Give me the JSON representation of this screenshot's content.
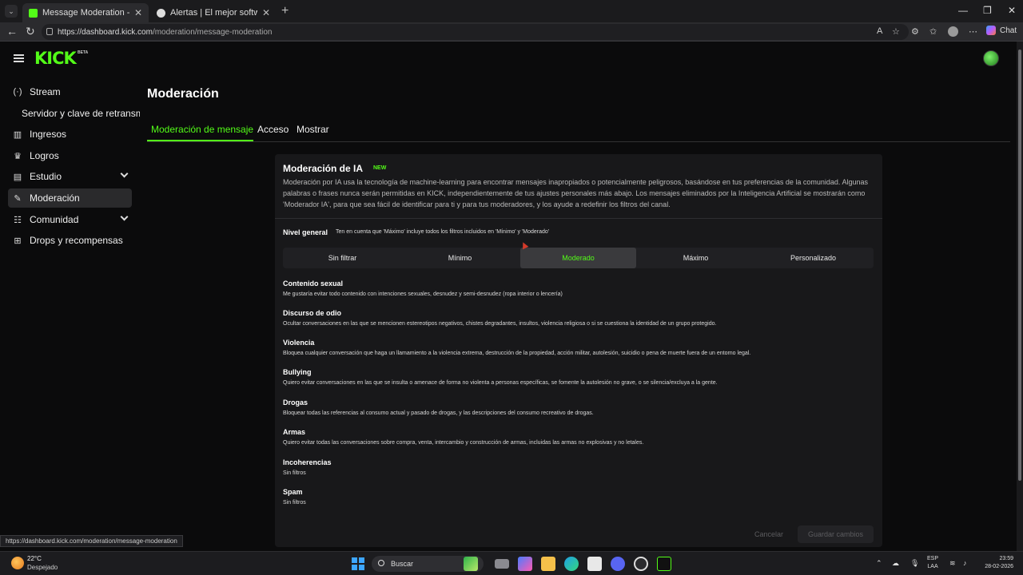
{
  "browser": {
    "tabs": [
      {
        "title": "Message Moderation - Kick Dashb",
        "active": true
      },
      {
        "title": "Alertas | El mejor software para po",
        "active": false
      }
    ],
    "url_host": "https://dashboard.kick.com",
    "url_path": "/moderation/message-moderation",
    "chat_label": "Chat",
    "status_url": "https://dashboard.kick.com/moderation/message-moderation"
  },
  "brand": {
    "logo": "KICK",
    "beta": "BETA",
    "accent": "#53fc18"
  },
  "sidebar": {
    "items": [
      {
        "icon": "stream-icon",
        "label": "Stream"
      },
      {
        "label": "Servidor y clave de retransmi"
      },
      {
        "icon": "income-icon",
        "label": "Ingresos"
      },
      {
        "icon": "trophy-icon",
        "label": "Logros"
      },
      {
        "icon": "studio-icon",
        "label": "Estudio"
      },
      {
        "icon": "wrench-icon",
        "label": "Moderación"
      },
      {
        "icon": "community-icon",
        "label": "Comunidad"
      },
      {
        "icon": "drops-icon",
        "label": "Drops y recompensas"
      }
    ]
  },
  "main": {
    "title": "Moderación",
    "tabs": [
      "Moderación de mensaje",
      "Acceso",
      "Mostrar"
    ]
  },
  "card": {
    "title": "Moderación de IA",
    "badge": "NEW",
    "description": "Moderación por IA usa la tecnología de machine-learning para encontrar mensajes inapropiados o potencialmente peligrosos, basándose en tus preferencias de la comunidad. Algunas palabras o frases nunca serán permitidas en KICK, independientemente de tus ajustes personales más abajo. Los mensajes eliminados por la Inteligencia Artificial se mostrarán como 'Moderador IA', para que sea fácil de identificar para ti y para tus moderadores, y los ayude a redefinir los filtros del canal.",
    "nivel_label": "Nivel general",
    "nivel_hint": "Ten en cuenta que 'Máximo' incluye todos los filtros incluidos en 'Mínimo' y 'Moderado'",
    "levels": [
      "Sin filtrar",
      "Mínimo",
      "Moderado",
      "Máximo",
      "Personalizado"
    ],
    "selected_level": "Moderado",
    "categories": [
      {
        "title": "Contenido sexual",
        "desc": "Me gustaría evitar todo contenido con intenciones sexuales, desnudez y semi-desnudez (ropa interior o lencería)"
      },
      {
        "title": "Discurso de odio",
        "desc": "Ocultar conversaciones en las que se mencionen estereotipos negativos, chistes degradantes, insultos, violencia religiosa o si se cuestiona la identidad de un grupo protegido."
      },
      {
        "title": "Violencia",
        "desc": "Bloquea cualquier conversación que haga un llamamiento a la violencia extrema, destrucción de la propiedad, acción militar, autolesión, suicidio o pena de muerte fuera de un entorno legal."
      },
      {
        "title": "Bullying",
        "desc": "Quiero evitar conversaciones en las que se insulta o amenace de forma no violenta a personas específicas, se fomente la autolesión no grave, o se silencia/excluya a la gente."
      },
      {
        "title": "Drogas",
        "desc": "Bloquear todas las referencias al consumo actual y pasado de drogas, y las descripciones del consumo recreativo de drogas."
      },
      {
        "title": "Armas",
        "desc": "Quiero evitar todas las conversaciones sobre compra, venta, intercambio y construcción de armas, incluidas las armas no explosivas y no letales."
      },
      {
        "title": "Incoherencias",
        "desc": "Sin filtros"
      },
      {
        "title": "Spam",
        "desc": "Sin filtros"
      }
    ],
    "cancel_label": "Cancelar",
    "save_label": "Guardar cambios"
  },
  "taskbar": {
    "temp": "22°C",
    "weather": "Despejado",
    "search_label": "Buscar",
    "lang_top": "ESP",
    "lang_bottom": "LAA",
    "time": "23:59",
    "date": "28-02-2026"
  }
}
